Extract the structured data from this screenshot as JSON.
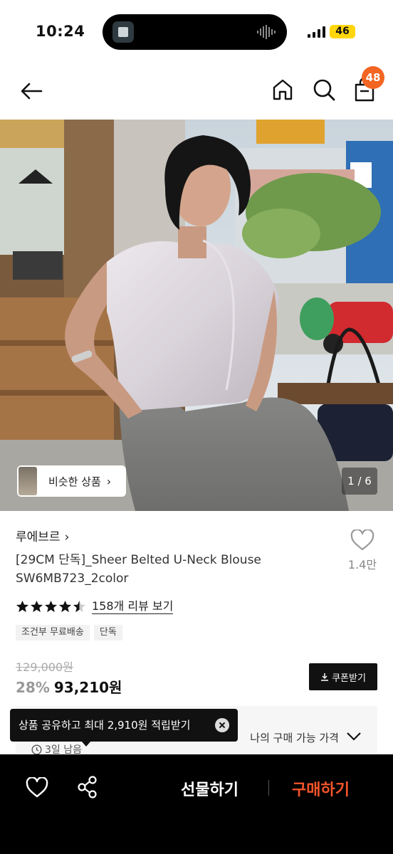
{
  "status_bar": {
    "time": "10:24",
    "battery": "46"
  },
  "header": {
    "cart_count": "48",
    "icons": [
      "back-arrow-icon",
      "home-icon",
      "search-icon",
      "shopping-bag-icon"
    ]
  },
  "gallery": {
    "similar_button_label": "비슷한 상품",
    "page_indicator": "1 / 6"
  },
  "product": {
    "brand": "루에브르",
    "title": "[29CM 단독]_Sheer Belted U-Neck Blouse SW6MB723_2color",
    "like_count": "1.4만",
    "rating": 4.5,
    "review_link": "158개 리뷰 보기",
    "tags": [
      "조건부 무료배송",
      "단독"
    ],
    "original_price": "129,000원",
    "discount_rate": "28%",
    "sale_price": "93,210원",
    "coupon_button": "쿠폰받기"
  },
  "my_price": {
    "label": "나의 구매 가능 가격",
    "timer": "3일 남음"
  },
  "toast": {
    "message": "상품 공유하고 최대 2,910원 적립받기"
  },
  "bottom_bar": {
    "gift_label": "선물하기",
    "buy_label": "구매하기"
  },
  "colors": {
    "accent_orange": "#f26522",
    "buy_red": "#f5552b",
    "bottom_bar_bg": "#000000"
  }
}
